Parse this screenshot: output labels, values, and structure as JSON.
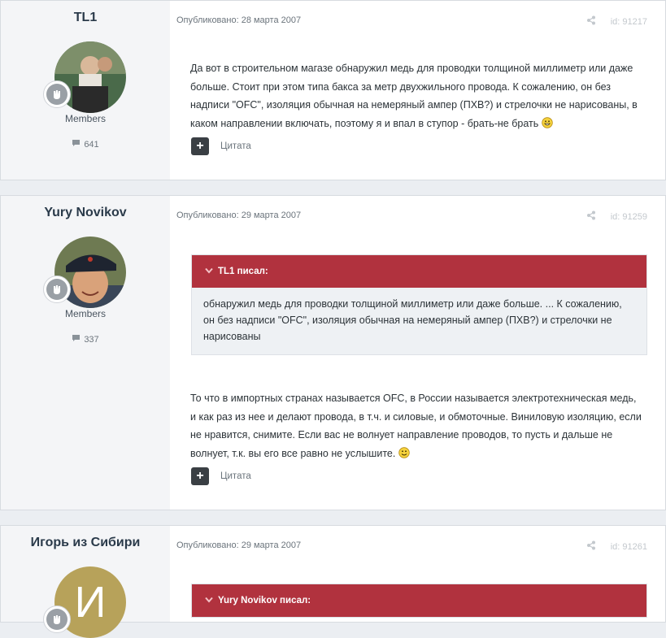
{
  "posts": [
    {
      "author": "TL1",
      "group": "Members",
      "post_count": "641",
      "published": "Опубликовано: 28 марта 2007",
      "id_label": "id: 91217",
      "body": "Да вот в строительном магазе обнаружил медь для проводки толщиной миллиметр или даже больше. Стоит при этом типа бакса за метр двухжильного провода. К сожалению, он без надписи \"OFC\", изоляция обычная на немеряный ампер (ПХВ?) и стрелочки не нарисованы, в каком направлении включать, поэтому я и впал в ступор - брать-не брать",
      "quote_label": "Цитата"
    },
    {
      "author": "Yury Novikov",
      "group": "Members",
      "post_count": "337",
      "published": "Опубликовано: 29 марта 2007",
      "id_label": "id: 91259",
      "quote_header": "TL1 писал:",
      "quote_text": "обнаружил медь для проводки толщиной миллиметр или даже больше. ... К сожалению, он без надписи \"OFC\", изоляция обычная на немеряный ампер (ПХВ?) и стрелочки не нарисованы",
      "body": "То что в импортных странах называется OFC, в России называется электротехническая медь, и как раз из нее и делают провода, в т.ч. и силовые, и обмоточные. Виниловую изоляцию, если не нравится, снимите. Если вас не волнует направление проводов, то пусть и дальше не волнует, т.к. вы его все равно не услышите.",
      "quote_label": "Цитата"
    },
    {
      "author": "Игорь из Сибири",
      "avatar_initial": "И",
      "published": "Опубликовано: 29 марта 2007",
      "id_label": "id: 91261",
      "quote_header": "Yury Novikov писал:"
    }
  ],
  "colors": {
    "quote_header": "#b1323e",
    "page_bg": "#ebeef2",
    "author_panel": "#f4f5f7"
  }
}
